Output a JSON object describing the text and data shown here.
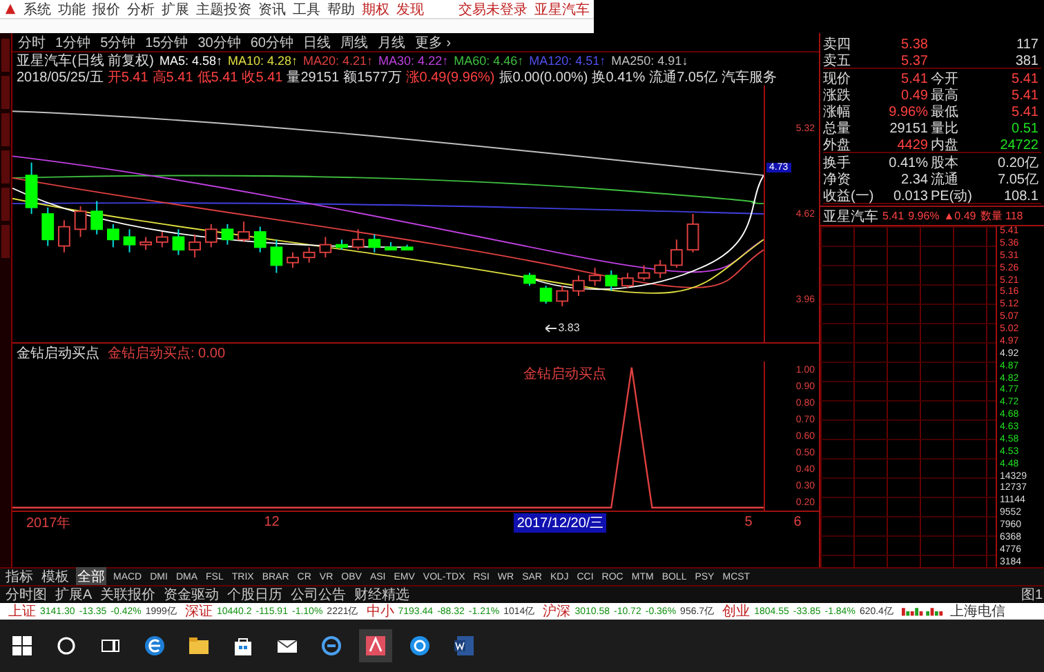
{
  "menu": {
    "items": [
      "系统",
      "功能",
      "报价",
      "分析",
      "扩展",
      "主题投资",
      "资讯",
      "工具",
      "帮助"
    ],
    "highlighted": [
      "期权",
      "发现"
    ],
    "status": [
      "交易未登录",
      "亚星汽车"
    ]
  },
  "periods": [
    "分时",
    "1分钟",
    "5分钟",
    "15分钟",
    "30分钟",
    "60分钟",
    "日线",
    "周线",
    "月线",
    "更多 ›"
  ],
  "chart_title": {
    "name": "亚星汽车(日线 前复权)",
    "averages": [
      {
        "label": "MA5: 4.58↑",
        "color": "#ffffff"
      },
      {
        "label": "MA10: 4.28↑",
        "color": "#e0e040"
      },
      {
        "label": "MA20: 4.21↑",
        "color": "#e04040"
      },
      {
        "label": "MA30: 4.22↑",
        "color": "#c040e0"
      },
      {
        "label": "MA60: 4.46↑",
        "color": "#40c040"
      },
      {
        "label": "MA120: 4.51↑",
        "color": "#5050f0"
      },
      {
        "label": "MA250: 4.91↓",
        "color": "#c0c0c0"
      }
    ]
  },
  "bar_info": [
    {
      "text": "2018/05/25/五",
      "color": "#dddddd"
    },
    {
      "text": "开5.41",
      "color": "#ff4040"
    },
    {
      "text": "高5.41",
      "color": "#ff4040"
    },
    {
      "text": "低5.41",
      "color": "#ff4040"
    },
    {
      "text": "收5.41",
      "color": "#ff4040"
    },
    {
      "text": "量29151",
      "color": "#dddddd"
    },
    {
      "text": "额1577万",
      "color": "#dddddd"
    },
    {
      "text": "涨0.49(9.96%)",
      "color": "#ff4040"
    },
    {
      "text": "振0.00(0.00%)",
      "color": "#dddddd"
    },
    {
      "text": "换0.41%",
      "color": "#dddddd"
    },
    {
      "text": "流通7.05亿",
      "color": "#dddddd"
    },
    {
      "text": "汽车服务",
      "color": "#dddddd"
    }
  ],
  "price_axis": [
    "5.32",
    "4.62",
    "3.96"
  ],
  "crosshair_price": "4.73",
  "low_marker": "3.83",
  "quote": [
    {
      "cells": [
        {
          "label": "卖四",
          "value": "5.38",
          "color": "#ff4040"
        },
        {
          "value": "117",
          "color": "#dddddd"
        }
      ]
    },
    {
      "cells": [
        {
          "label": "卖五",
          "value": "5.37",
          "color": "#ff4040"
        },
        {
          "value": "381",
          "color": "#dddddd"
        }
      ]
    },
    {
      "cells": [
        {
          "label": "现价",
          "value": "5.41",
          "color": "#ff4040"
        },
        {
          "label": "今开",
          "value": "5.41",
          "color": "#ff4040"
        }
      ]
    },
    {
      "cells": [
        {
          "label": "涨跌",
          "value": "0.49",
          "color": "#ff4040"
        },
        {
          "label": "最高",
          "value": "5.41",
          "color": "#ff4040"
        }
      ]
    },
    {
      "cells": [
        {
          "label": "涨幅",
          "value": "9.96%",
          "color": "#ff4040"
        },
        {
          "label": "最低",
          "value": "5.41",
          "color": "#ff4040"
        }
      ]
    },
    {
      "cells": [
        {
          "label": "总量",
          "value": "29151",
          "color": "#dddddd"
        },
        {
          "label": "量比",
          "value": "0.51",
          "color": "#20e020"
        }
      ]
    },
    {
      "cells": [
        {
          "label": "外盘",
          "value": "4429",
          "color": "#ff4040"
        },
        {
          "label": "内盘",
          "value": "24722",
          "color": "#20e020"
        }
      ]
    },
    {
      "cells": [
        {
          "label": "换手",
          "value": "0.41%",
          "color": "#dddddd"
        },
        {
          "label": "股本",
          "value": "0.20亿",
          "color": "#dddddd"
        }
      ]
    },
    {
      "cells": [
        {
          "label": "净资",
          "value": "2.34",
          "color": "#dddddd"
        },
        {
          "label": "流通",
          "value": "7.05亿",
          "color": "#dddddd"
        }
      ]
    },
    {
      "cells": [
        {
          "label": "收益(一)",
          "value": "0.013",
          "color": "#dddddd"
        },
        {
          "label": "PE(动)",
          "value": "108.1",
          "color": "#dddddd"
        }
      ]
    }
  ],
  "mini_header": [
    "亚星汽车",
    "5.41",
    "9.96%",
    "▲0.49",
    "数量 118"
  ],
  "ladder": [
    {
      "text": "5.41",
      "color": "#ff4040"
    },
    {
      "text": "5.36",
      "color": "#ff4040"
    },
    {
      "text": "5.31",
      "color": "#ff4040"
    },
    {
      "text": "5.26",
      "color": "#ff4040"
    },
    {
      "text": "5.21",
      "color": "#ff4040"
    },
    {
      "text": "5.16",
      "color": "#ff4040"
    },
    {
      "text": "5.12",
      "color": "#ff4040"
    },
    {
      "text": "5.07",
      "color": "#ff4040"
    },
    {
      "text": "5.02",
      "color": "#ff4040"
    },
    {
      "text": "4.97",
      "color": "#ff4040"
    },
    {
      "text": "4.92",
      "color": "#dddddd"
    },
    {
      "text": "4.87",
      "color": "#20e020"
    },
    {
      "text": "4.82",
      "color": "#20e020"
    },
    {
      "text": "4.77",
      "color": "#20e020"
    },
    {
      "text": "4.72",
      "color": "#20e020"
    },
    {
      "text": "4.68",
      "color": "#20e020"
    },
    {
      "text": "4.63",
      "color": "#20e020"
    },
    {
      "text": "4.58",
      "color": "#20e020"
    },
    {
      "text": "4.53",
      "color": "#20e020"
    },
    {
      "text": "4.48",
      "color": "#20e020"
    },
    {
      "text": "14329",
      "color": "#dddddd"
    },
    {
      "text": "12737",
      "color": "#dddddd"
    },
    {
      "text": "11144",
      "color": "#dddddd"
    },
    {
      "text": "9552",
      "color": "#dddddd"
    },
    {
      "text": "7960",
      "color": "#dddddd"
    },
    {
      "text": "6368",
      "color": "#dddddd"
    },
    {
      "text": "4776",
      "color": "#dddddd"
    },
    {
      "text": "3184",
      "color": "#dddddd"
    }
  ],
  "indicator": {
    "name": "金钻启动买点",
    "reading": "金钻启动买点: 0.00",
    "peak_label": "金钻启动买点",
    "axis": [
      "1.00",
      "0.90",
      "0.80",
      "0.70",
      "0.60",
      "0.50",
      "0.40",
      "0.30",
      "0.20"
    ]
  },
  "dates": [
    {
      "text": "2017年",
      "selected": false
    },
    {
      "text": "12",
      "selected": false
    },
    {
      "text": "2017/12/20/三",
      "selected": true
    },
    {
      "text": "5",
      "selected": false
    },
    {
      "text": "6",
      "selected": false
    }
  ],
  "indicator_tabs": [
    {
      "label": "指标",
      "selected": false
    },
    {
      "label": "模板",
      "selected": false
    },
    {
      "label": "全部",
      "selected": true
    },
    {
      "label": "MACD",
      "selected": false
    },
    {
      "label": "DMI",
      "selected": false
    },
    {
      "label": "DMA",
      "selected": false
    },
    {
      "label": "FSL",
      "selected": false
    },
    {
      "label": "TRIX",
      "selected": false
    },
    {
      "label": "BRAR",
      "selected": false
    },
    {
      "label": "CR",
      "selected": false
    },
    {
      "label": "VR",
      "selected": false
    },
    {
      "label": "OBV",
      "selected": false
    },
    {
      "label": "ASI",
      "selected": false
    },
    {
      "label": "EMV",
      "selected": false
    },
    {
      "label": "VOL-TDX",
      "selected": false
    },
    {
      "label": "RSI",
      "selected": false
    },
    {
      "label": "WR",
      "selected": false
    },
    {
      "label": "SAR",
      "selected": false
    },
    {
      "label": "KDJ",
      "selected": false
    },
    {
      "label": "CCI",
      "selected": false
    },
    {
      "label": "ROC",
      "selected": false
    },
    {
      "label": "MTM",
      "selected": false
    },
    {
      "label": "BOLL",
      "selected": false
    },
    {
      "label": "PSY",
      "selected": false
    },
    {
      "label": "MCST",
      "selected": false
    }
  ],
  "info_tabs": [
    "分时图",
    "扩展A",
    "关联报价",
    "资金驱动",
    "个股日历",
    "公司公告",
    "财经精选"
  ],
  "layout_tab": "图1",
  "indices": [
    {
      "name": "上证",
      "value": "3141.30",
      "change": "-13.35",
      "pct": "-0.42%",
      "amount": "1999亿"
    },
    {
      "name": "深证",
      "value": "10440.2",
      "change": "-115.91",
      "pct": "-1.10%",
      "amount": "2221亿"
    },
    {
      "name": "中小",
      "value": "7193.44",
      "change": "-88.32",
      "pct": "-1.21%",
      "amount": "1014亿"
    },
    {
      "name": "沪深",
      "value": "3010.58",
      "change": "-10.72",
      "pct": "-0.36%",
      "amount": "956.7亿"
    },
    {
      "name": "创业",
      "value": "1804.55",
      "change": "-33.85",
      "pct": "-1.84%",
      "amount": "620.4亿"
    }
  ],
  "news": "上海电信"
}
